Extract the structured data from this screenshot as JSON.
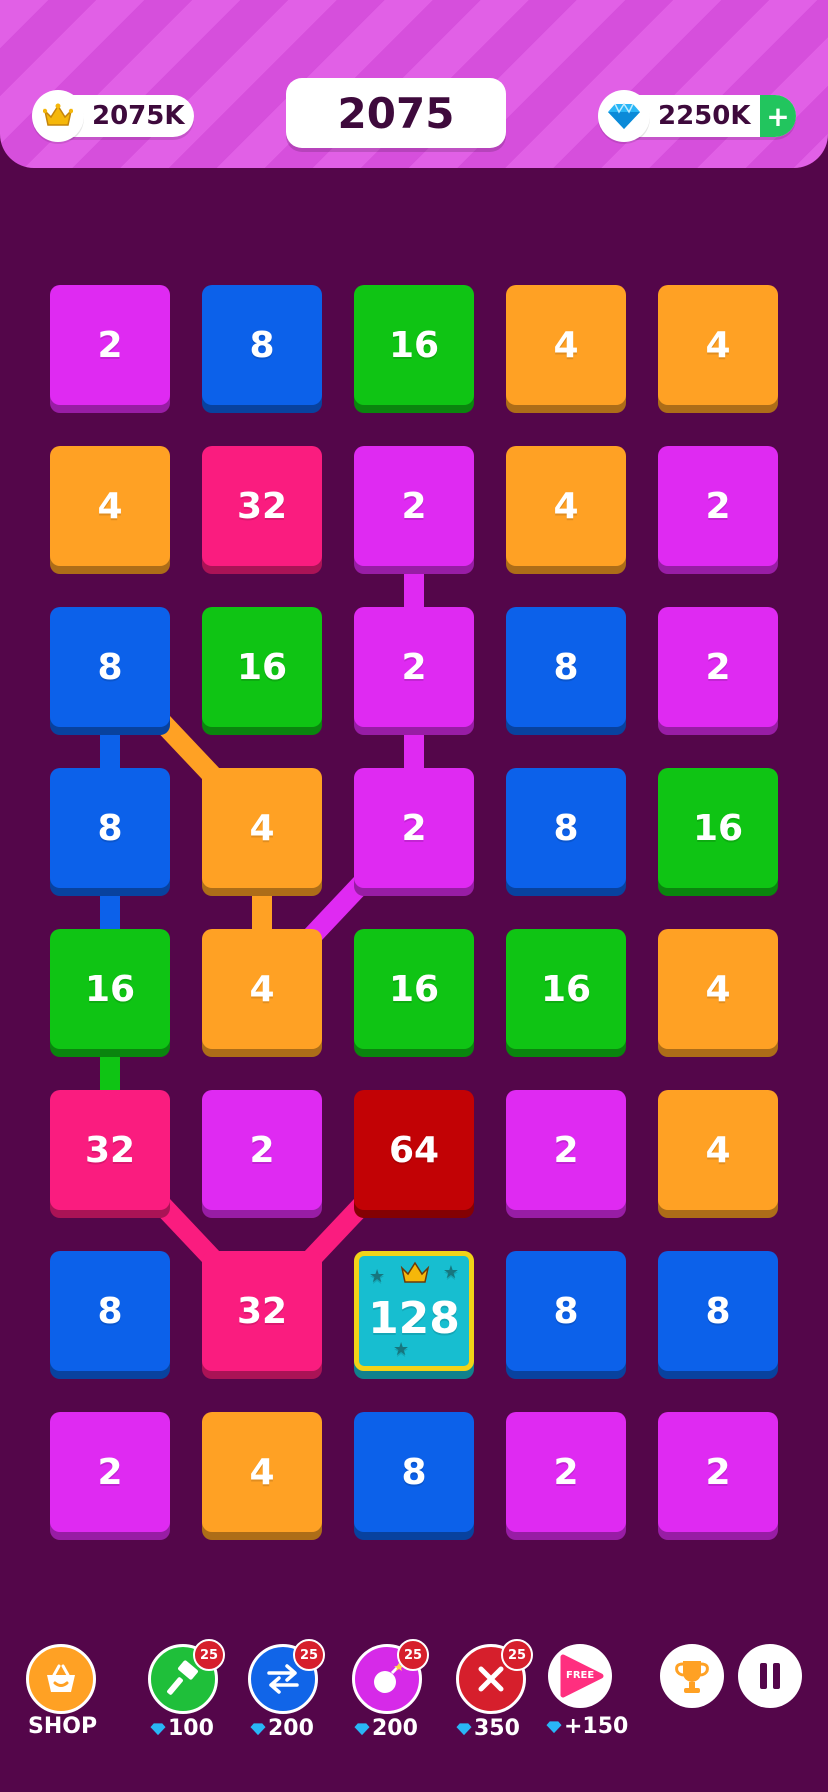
{
  "header": {
    "crowns": "2075K",
    "score": "2075",
    "gems": "2250K",
    "add_label": "+"
  },
  "colors": {
    "2": "#df2af2",
    "4": "#ffa124",
    "8": "#0c61ea",
    "16": "#0fc414",
    "32": "#fa1c7f",
    "64": "#c20205",
    "128": "#17bed0"
  },
  "grid": [
    [
      "2",
      "8",
      "16",
      "4",
      "4"
    ],
    [
      "4",
      "32",
      "2",
      "4",
      "2"
    ],
    [
      "8",
      "16",
      "2",
      "8",
      "2"
    ],
    [
      "8",
      "4",
      "2",
      "8",
      "16"
    ],
    [
      "16",
      "4",
      "16",
      "16",
      "4"
    ],
    [
      "32",
      "2",
      "64",
      "2",
      "4"
    ],
    [
      "8",
      "32",
      "128",
      "8",
      "8"
    ],
    [
      "2",
      "4",
      "8",
      "2",
      "2"
    ]
  ],
  "toolbar": {
    "shop_label": "SHOP",
    "hammer_badge": "25",
    "hammer_cost": "100",
    "swap_badge": "25",
    "swap_cost": "200",
    "bomb_badge": "25",
    "bomb_cost": "200",
    "remove_badge": "25",
    "remove_cost": "350",
    "free_label": "FREE",
    "free_reward": "+150"
  }
}
